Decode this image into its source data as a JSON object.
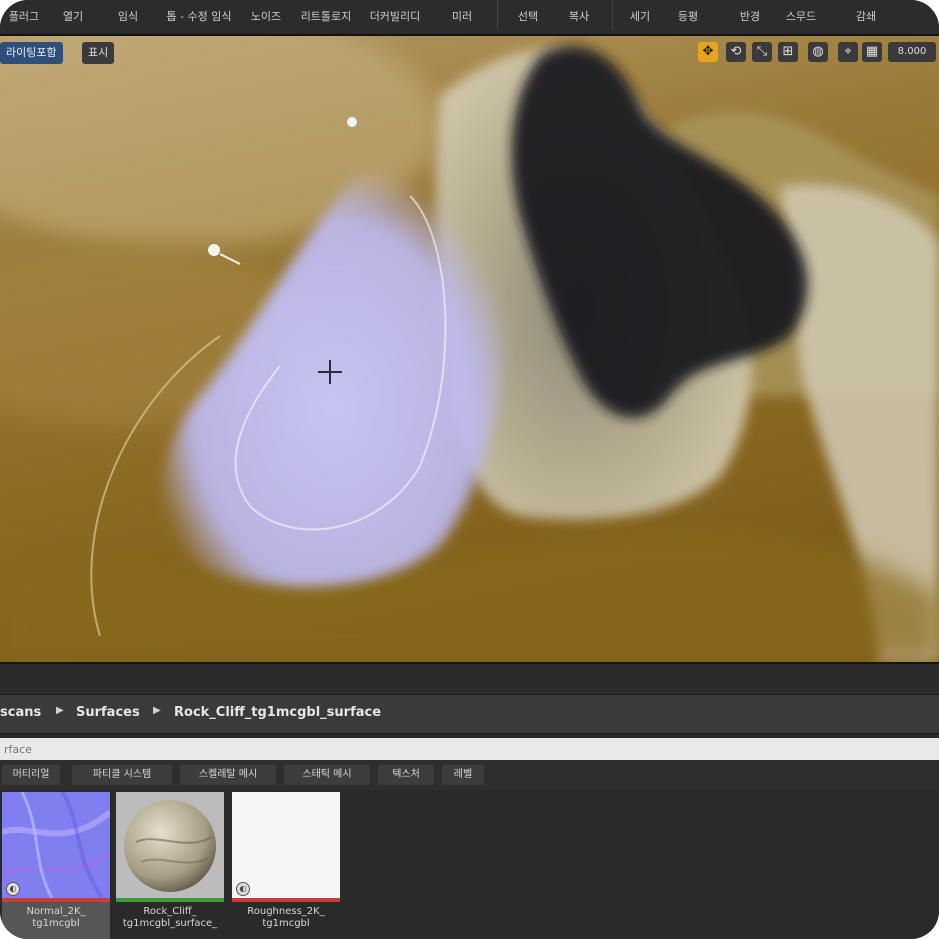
{
  "toolbar": {
    "items": [
      {
        "label": "플러그",
        "name": "toolbar-plugins"
      },
      {
        "label": "열기",
        "name": "toolbar-open"
      },
      {
        "label": "임식",
        "name": "toolbar-item-3"
      },
      {
        "label": "톱 - 수정 임식",
        "name": "toolbar-item-4"
      },
      {
        "label": "노이즈",
        "name": "toolbar-noise"
      },
      {
        "label": "리트톨로지",
        "name": "toolbar-item-6"
      },
      {
        "label": "더커빌리디",
        "name": "toolbar-item-7"
      },
      {
        "label": "미러",
        "name": "toolbar-mirror"
      },
      {
        "label": "선택",
        "name": "toolbar-select"
      },
      {
        "label": "복사",
        "name": "toolbar-copy"
      },
      {
        "label": "세기",
        "name": "toolbar-strength"
      },
      {
        "label": "등평",
        "name": "toolbar-item-12"
      },
      {
        "label": "반경",
        "name": "toolbar-radius"
      },
      {
        "label": "스무드",
        "name": "toolbar-smooth"
      },
      {
        "label": "감쇄",
        "name": "toolbar-falloff"
      }
    ]
  },
  "viewport": {
    "view_mode": "라이팅포함",
    "show": "표시",
    "speed": "8.000",
    "icons": [
      "move-icon",
      "rotate-icon",
      "scale-icon",
      "grid-icon",
      "globe-icon",
      "snap-icon",
      "camera-speed-icon"
    ]
  },
  "breadcrumb": {
    "items": [
      "scans",
      "Surfaces",
      "Rock_Cliff_tg1mcgbl_surface"
    ]
  },
  "search": {
    "placeholder": "rface"
  },
  "filters": [
    "머티리얼",
    "파티클 시스템",
    "스켈레탈 메시",
    "스태틱 메시",
    "텍스처",
    "레벨"
  ],
  "assets": [
    {
      "label": "Normal_2K_\ntg1mcgbl",
      "stripe_color": "#c83c3c",
      "selected": true
    },
    {
      "label": "Rock_Cliff_\ntg1mcgbl_surface_",
      "stripe_color": "#3c9a3c",
      "selected": false
    },
    {
      "label": "Roughness_2K_\ntg1mcgbl",
      "stripe_color": "#c83c3c",
      "selected": false
    }
  ],
  "colors": {
    "accent": "#e8a41c",
    "brush": "#b9b6f2"
  }
}
